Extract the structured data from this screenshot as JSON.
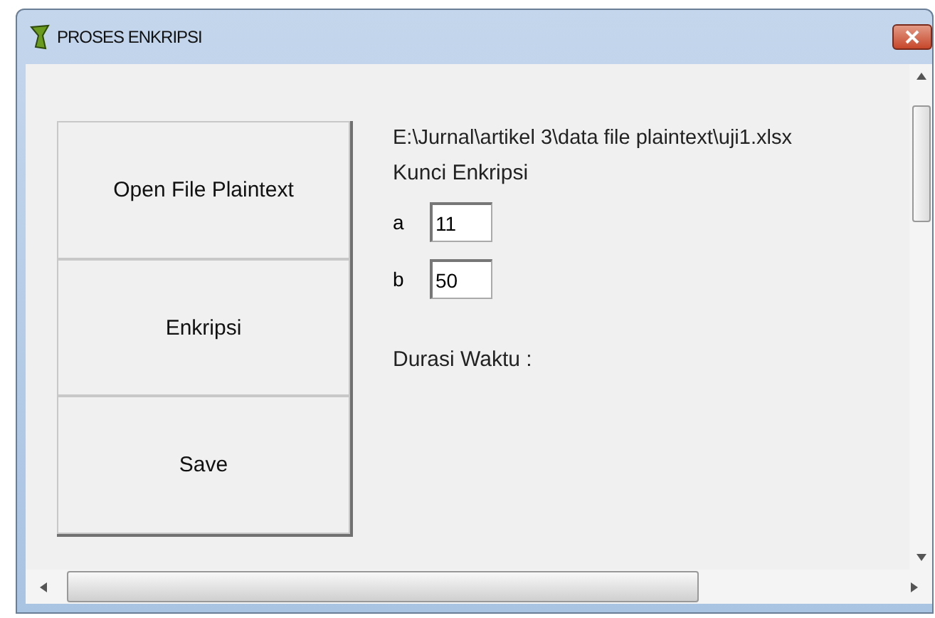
{
  "window": {
    "title": "PROSES ENKRIPSI"
  },
  "buttons": [
    "Open File Plaintext",
    "Enkripsi",
    "Save"
  ],
  "file_path": "E:\\Jurnal\\artikel 3\\data file plaintext\\uji1.xlsx",
  "key_heading": "Kunci Enkripsi",
  "fields": [
    {
      "label": "a",
      "value": "11"
    },
    {
      "label": "b",
      "value": "50"
    }
  ],
  "duration_label": "Durasi Waktu :"
}
